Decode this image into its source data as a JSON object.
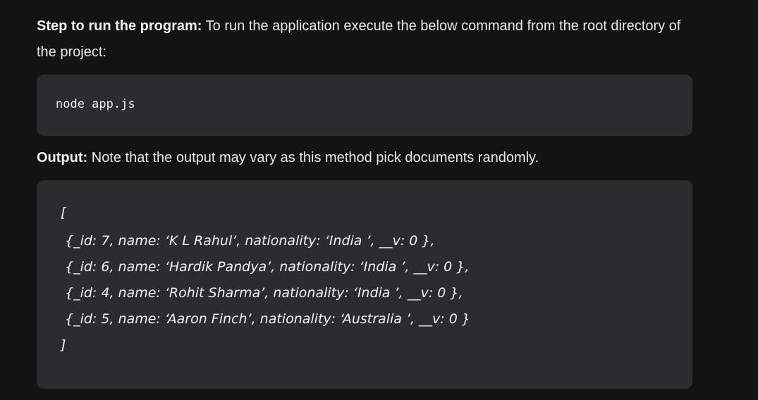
{
  "step": {
    "label": "Step to run the program:",
    "text": " To run the application execute the below command from the root directory of the project:"
  },
  "command": "node app.js",
  "output": {
    "label": "Output:",
    "text": " Note that the output may vary as this method pick documents randomly.",
    "lines": [
      "[",
      "{_id: 7, name: ‘K L Rahul’, nationality: ‘India ’, __v: 0 },",
      "{_id: 6, name: ‘Hardik Pandya’, nationality: ‘India ’, __v: 0 },",
      "{_id: 4, name: ‘Rohit Sharma’, nationality: ‘India ’, __v: 0 },",
      "{_id: 5, name: ‘Aaron Finch’, nationality: ‘Australia ’, __v: 0 }",
      "]"
    ]
  }
}
